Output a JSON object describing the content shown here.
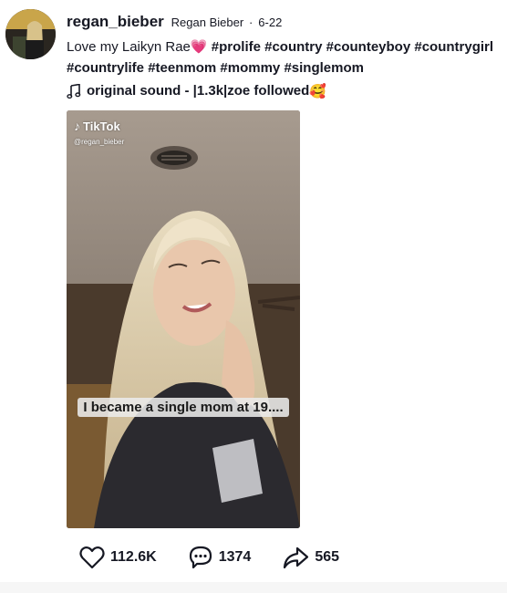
{
  "post": {
    "username": "regan_bieber",
    "display_name": "Regan Bieber",
    "separator": "·",
    "date": "6-22",
    "description_text": "Love my Laikyn Rae",
    "description_emoji": "💗",
    "hashtags": [
      "#prolife",
      "#country",
      "#counteyboy",
      "#countrygirl",
      "#countrylife",
      "#teenmom",
      "#mommy",
      "#singlemom"
    ],
    "sound_text": "original sound - |1.3k|zoe followed",
    "sound_emoji": "🥰"
  },
  "video": {
    "brand": "TikTok",
    "handle": "@regan_bieber",
    "caption": "I became a single mom at 19...."
  },
  "stats": {
    "likes": "112.6K",
    "comments": "1374",
    "shares": "565"
  },
  "icons": {
    "like": "heart-icon",
    "comment": "comment-icon",
    "share": "share-icon",
    "sound": "music-note-icon"
  }
}
